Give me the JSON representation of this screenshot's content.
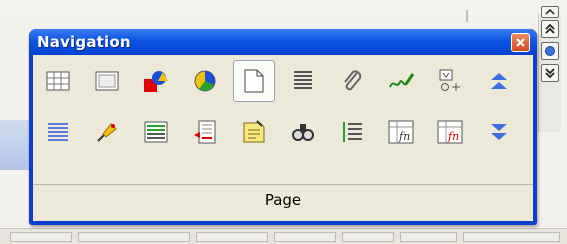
{
  "window": {
    "title": "Navigation",
    "close_label": "×"
  },
  "toolbar": {
    "row1": [
      {
        "name": "table-icon"
      },
      {
        "name": "frame-icon"
      },
      {
        "name": "graphics-icon"
      },
      {
        "name": "ole-object-icon"
      },
      {
        "name": "page-icon",
        "selected": true
      },
      {
        "name": "headings-icon"
      },
      {
        "name": "attachment-icon"
      },
      {
        "name": "signature-icon"
      },
      {
        "name": "control-icon"
      },
      {
        "name": "previous-arrow-icon"
      }
    ],
    "row2": [
      {
        "name": "paragraph-icon"
      },
      {
        "name": "marker-icon"
      },
      {
        "name": "section-icon"
      },
      {
        "name": "footnote-icon"
      },
      {
        "name": "note-icon"
      },
      {
        "name": "find-icon"
      },
      {
        "name": "list-icon"
      },
      {
        "name": "formula-icon"
      },
      {
        "name": "formula-error-icon"
      },
      {
        "name": "next-arrow-icon"
      }
    ]
  },
  "status": {
    "label": "Page"
  },
  "colors": {
    "titlebar": "#0642d2",
    "panel": "#ece9d8",
    "close": "#d5461f"
  }
}
